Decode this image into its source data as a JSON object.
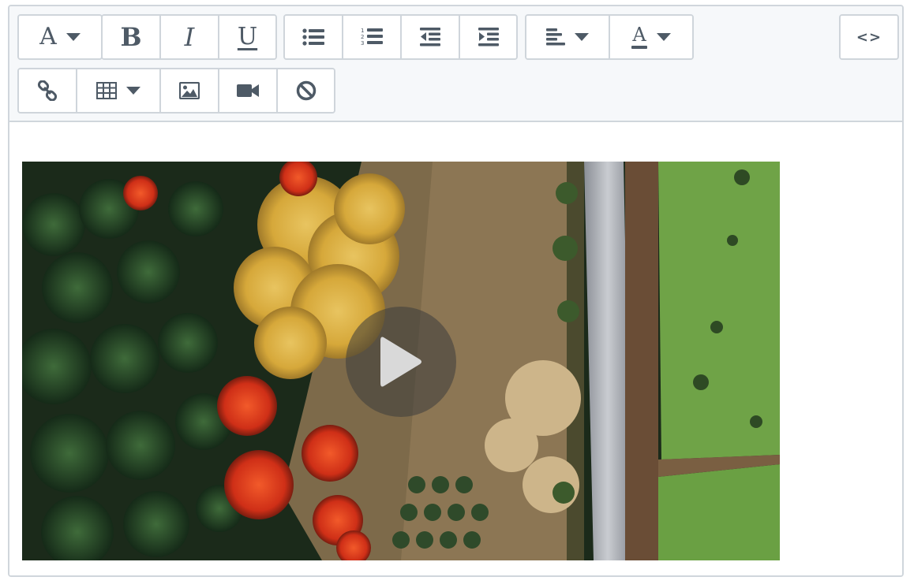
{
  "toolbar": {
    "row1": [
      {
        "group": "font",
        "buttons": [
          {
            "name": "font-style",
            "label": "A",
            "icon": "font-icon",
            "dropdown": true
          }
        ]
      },
      {
        "group": "text-format",
        "buttons": [
          {
            "name": "bold",
            "label": "B",
            "icon": "bold-icon"
          },
          {
            "name": "italic",
            "label": "I",
            "icon": "italic-icon"
          },
          {
            "name": "underline",
            "label": "U",
            "icon": "underline-icon"
          }
        ]
      },
      {
        "group": "lists",
        "buttons": [
          {
            "name": "unordered-list",
            "icon": "bullet-list-icon"
          },
          {
            "name": "ordered-list",
            "icon": "numbered-list-icon"
          },
          {
            "name": "outdent",
            "icon": "outdent-icon"
          },
          {
            "name": "indent",
            "icon": "indent-icon"
          }
        ]
      },
      {
        "group": "alignment-color",
        "buttons": [
          {
            "name": "align",
            "icon": "align-left-icon",
            "dropdown": true
          },
          {
            "name": "text-color",
            "label": "A",
            "icon": "text-color-icon",
            "dropdown": true
          }
        ]
      },
      {
        "group": "source",
        "buttons": [
          {
            "name": "code-view",
            "label": "<>",
            "icon": "code-icon"
          }
        ]
      }
    ],
    "row2": [
      {
        "group": "insert",
        "buttons": [
          {
            "name": "link",
            "icon": "link-icon"
          },
          {
            "name": "table",
            "icon": "table-icon",
            "dropdown": true
          },
          {
            "name": "image",
            "icon": "image-icon"
          },
          {
            "name": "video",
            "icon": "video-icon"
          },
          {
            "name": "clear-format",
            "icon": "clear-format-icon"
          }
        ]
      }
    ]
  },
  "labels": {
    "font": "A",
    "bold": "B",
    "italic": "I",
    "underline": "U",
    "text_color": "A",
    "code": "<>"
  },
  "content": {
    "video": {
      "thumbnail": "aerial-autumn-forest",
      "play_icon": "play-icon"
    }
  },
  "colors": {
    "icon": "#4e5a66",
    "toolbar_bg": "#f6f8fa",
    "border": "#d0d6dc"
  }
}
